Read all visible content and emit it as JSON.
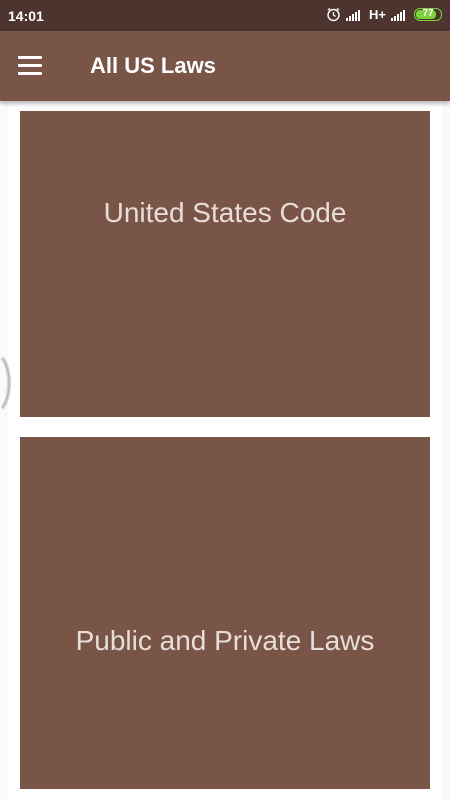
{
  "status_bar": {
    "time": "14:01",
    "network": "H+",
    "battery": "77"
  },
  "app_bar": {
    "title": "All US Laws",
    "menu_icon": "hamburger-menu-icon"
  },
  "cards": [
    {
      "label": "United States Code"
    },
    {
      "label": "Public and Private Laws"
    }
  ],
  "colors": {
    "status_bar": "#4e342e",
    "app_bar": "#795548",
    "card": "#795548",
    "card_text": "#e8ddd8",
    "battery": "#7bd53a"
  }
}
